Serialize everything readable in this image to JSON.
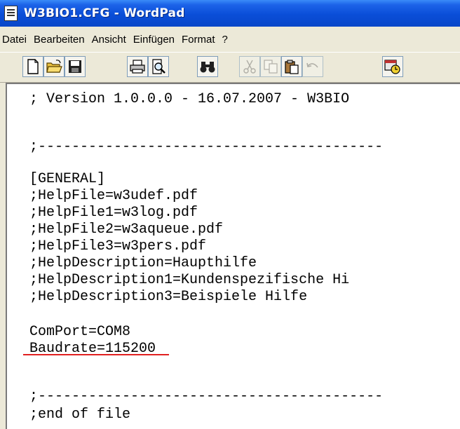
{
  "window": {
    "title": "W3BIO1.CFG - WordPad",
    "app_icon": "document-icon"
  },
  "menu": {
    "items": [
      "Datei",
      "Bearbeiten",
      "Ansicht",
      "Einfügen",
      "Format",
      "?"
    ]
  },
  "toolbar": {
    "buttons": [
      {
        "name": "new-document-icon",
        "enabled": true
      },
      {
        "name": "open-folder-icon",
        "enabled": true
      },
      {
        "name": "save-disk-icon",
        "enabled": true
      },
      {
        "name": "print-icon",
        "enabled": true
      },
      {
        "name": "print-preview-icon",
        "enabled": true
      },
      {
        "name": "find-binoculars-icon",
        "enabled": true
      },
      {
        "name": "cut-scissors-icon",
        "enabled": false
      },
      {
        "name": "copy-icon",
        "enabled": false
      },
      {
        "name": "paste-icon",
        "enabled": true
      },
      {
        "name": "undo-icon",
        "enabled": false
      },
      {
        "name": "insert-date-time-icon",
        "enabled": true
      }
    ]
  },
  "document": {
    "lines": [
      "; Version 1.0.0.0 - 16.07.2007 - W3BIO",
      "",
      ";-----------------------------------------",
      "",
      "[GENERAL]",
      ";HelpFile=w3udef.pdf",
      ";HelpFile1=w3log.pdf",
      ";HelpFile2=w3aqueue.pdf",
      ";HelpFile3=w3pers.pdf",
      ";HelpDescription=Haupthilfe",
      ";HelpDescription1=Kundenspezifische Hi",
      ";HelpDescription3=Beispiele Hilfe",
      "",
      "ComPort=COM8",
      "Baudrate=115200",
      "",
      ";-----------------------------------------",
      ";end of file"
    ],
    "highlight": {
      "line": "ComPort=COM8",
      "underline_color": "#e02020"
    }
  }
}
